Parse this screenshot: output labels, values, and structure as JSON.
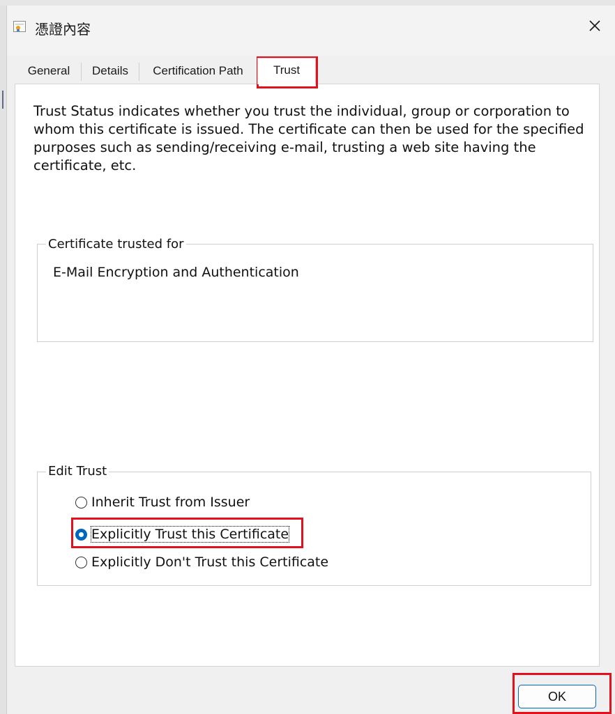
{
  "window": {
    "title": "憑證內容",
    "icon": "certificate-icon",
    "close_icon": "close-icon"
  },
  "tabs": [
    {
      "label": "General"
    },
    {
      "label": "Details"
    },
    {
      "label": "Certification Path"
    },
    {
      "label": "Trust",
      "active": true
    }
  ],
  "trust": {
    "description": "Trust Status indicates whether you trust the individual, group or corporation to whom this certificate is issued.  The certificate can then be used for the specified purposes such as sending/receiving e-mail, trusting a web site having the certificate, etc.",
    "trusted_for_label": "Certificate trusted for",
    "trusted_for_value": "E-Mail Encryption and Authentication",
    "edit_trust_label": "Edit Trust",
    "options": [
      {
        "label": "Inherit Trust from Issuer",
        "selected": false
      },
      {
        "label": "Explicitly Trust this Certificate",
        "selected": true
      },
      {
        "label": "Explicitly Don't Trust this Certificate",
        "selected": false
      }
    ]
  },
  "buttons": {
    "ok_label": "OK"
  },
  "colors": {
    "highlight": "#e3111c",
    "accent": "#0067c0"
  }
}
